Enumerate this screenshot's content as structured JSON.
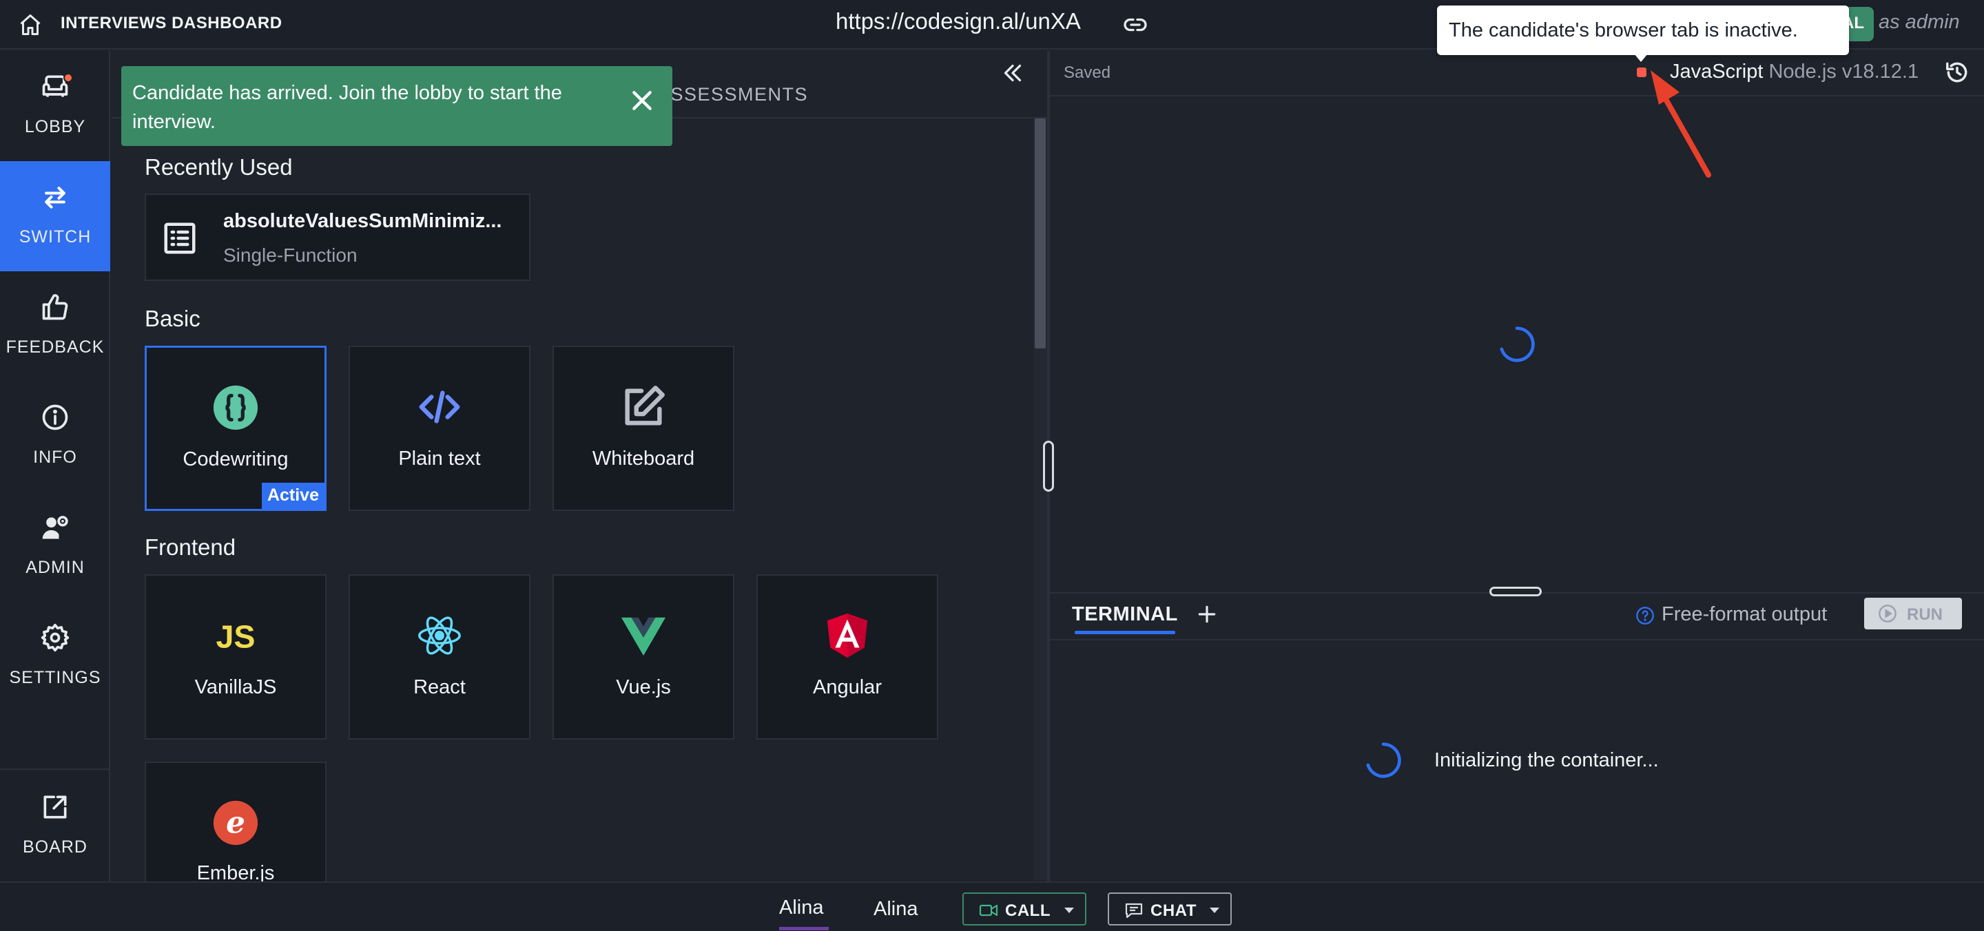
{
  "topbar": {
    "title": "INTERVIEWS DASHBOARD",
    "url": "https://codesign.al/unXA",
    "avatar_initials": "AL",
    "role": "as admin"
  },
  "tooltip": {
    "text": "The candidate's browser tab is inactive."
  },
  "rail": {
    "items": [
      {
        "label": "LOBBY",
        "icon": "sofa-icon"
      },
      {
        "label": "SWITCH",
        "icon": "switch-arrows-icon"
      },
      {
        "label": "FEEDBACK",
        "icon": "thumbs-up-icon"
      },
      {
        "label": "INFO",
        "icon": "info-icon"
      },
      {
        "label": "ADMIN",
        "icon": "user-gear-icon"
      },
      {
        "label": "SETTINGS",
        "icon": "gear-icon"
      },
      {
        "label": "BOARD",
        "icon": "external-link-icon"
      }
    ]
  },
  "panel": {
    "tab_assessments": "ASSESSMENTS",
    "toast": "Candidate has arrived. Join the lobby to start the interview.",
    "recent": {
      "title": "Recently Used",
      "item_name": "absoluteValuesSumMinimiz...",
      "item_type": "Single-Function"
    },
    "basic": {
      "title": "Basic",
      "items": [
        {
          "name": "Codewriting",
          "badge": "Active"
        },
        {
          "name": "Plain text"
        },
        {
          "name": "Whiteboard"
        }
      ]
    },
    "frontend": {
      "title": "Frontend",
      "items": [
        {
          "name": "VanillaJS"
        },
        {
          "name": "React"
        },
        {
          "name": "Vue.js"
        },
        {
          "name": "Angular"
        },
        {
          "name": "Ember.js"
        }
      ]
    }
  },
  "editor": {
    "status": "Saved",
    "language": "JavaScript",
    "runtime": "Node.js v18.12.1"
  },
  "terminal": {
    "tab": "TERMINAL",
    "output_mode": "Free-format output",
    "run": "RUN",
    "init": "Initializing the container..."
  },
  "bottom": {
    "user1": "Alina",
    "user2": "Alina",
    "call": "CALL",
    "chat": "CHAT"
  },
  "colors": {
    "accent": "#2f6ff0",
    "toast": "#3a8a66",
    "inactive_dot": "#ff5a4a"
  }
}
